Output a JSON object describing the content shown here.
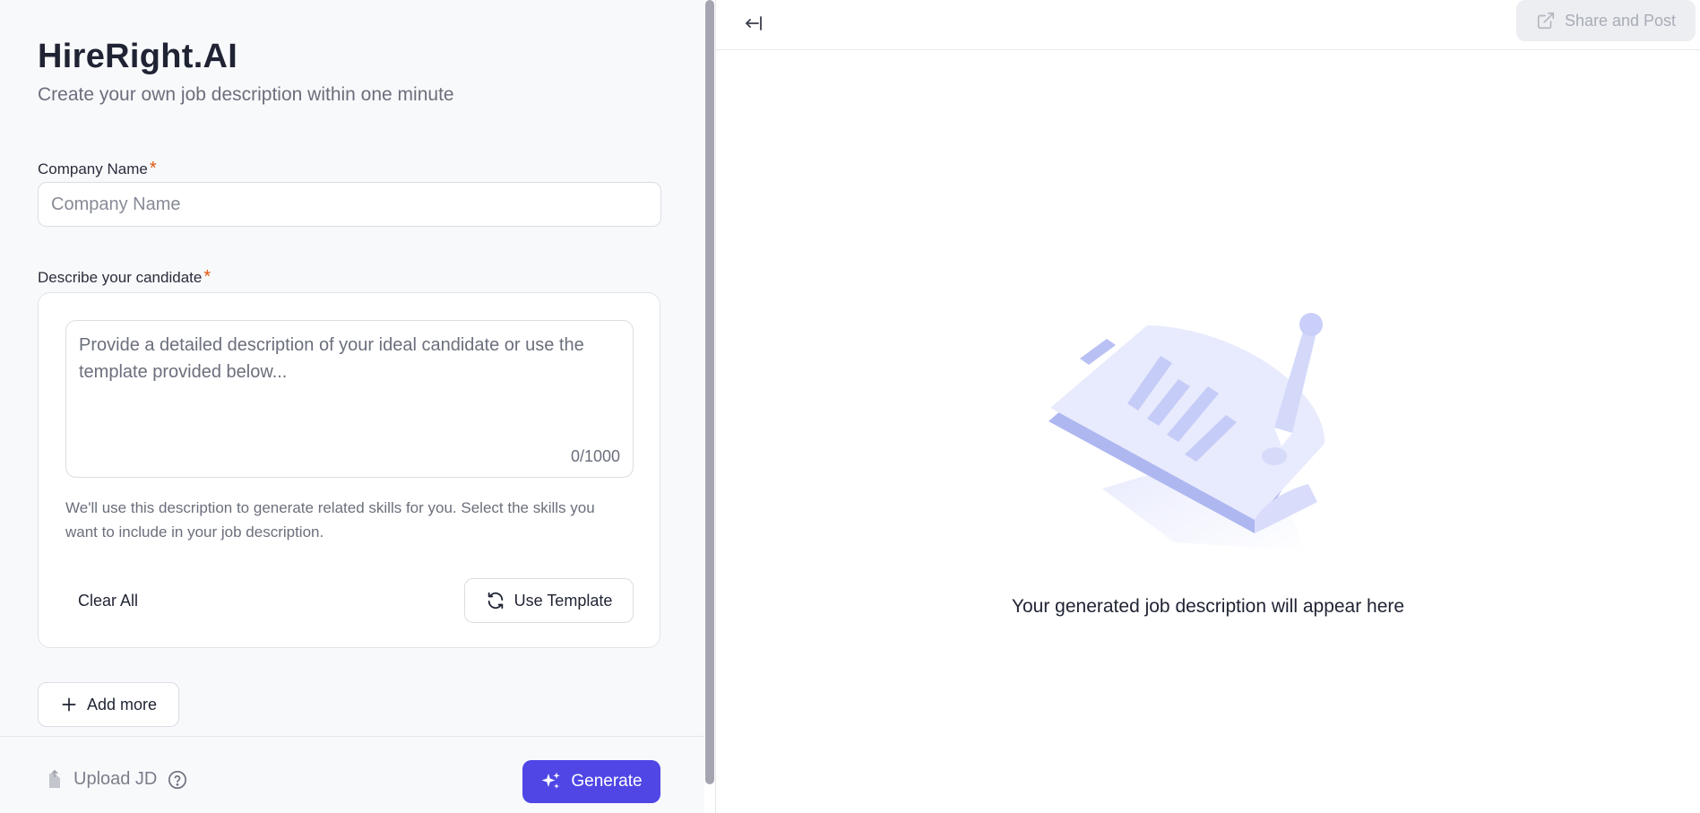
{
  "header": {
    "title": "HireRight.AI",
    "subtitle": "Create your own job description within one minute"
  },
  "form": {
    "company_label": "Company Name",
    "company_placeholder": "Company Name",
    "company_value": "",
    "candidate_label": "Describe your candidate",
    "required_mark": "*",
    "description_placeholder": "Provide a detailed description of your ideal candidate or use the template provided below...",
    "description_value": "",
    "char_count": "0/1000",
    "help_text": "We'll use this description to generate related skills for you. Select the skills you want to include in your job description.",
    "clear_label": "Clear All",
    "template_label": "Use Template",
    "add_more_label": "Add more"
  },
  "footer": {
    "upload_label": "Upload JD",
    "generate_label": "Generate"
  },
  "preview": {
    "share_label": "Share and Post",
    "empty_message": "Your generated job description will appear here"
  },
  "colors": {
    "primary": "#4f46e5",
    "required": "#e0580e",
    "illustration": "#c7cdf7"
  },
  "icons": {
    "collapse": "arrow-left-bar-icon",
    "share": "external-link-icon",
    "template": "refresh-icon",
    "add": "plus-icon",
    "upload": "upload-file-icon",
    "help": "question-circle-icon",
    "generate": "sparkles-icon"
  }
}
